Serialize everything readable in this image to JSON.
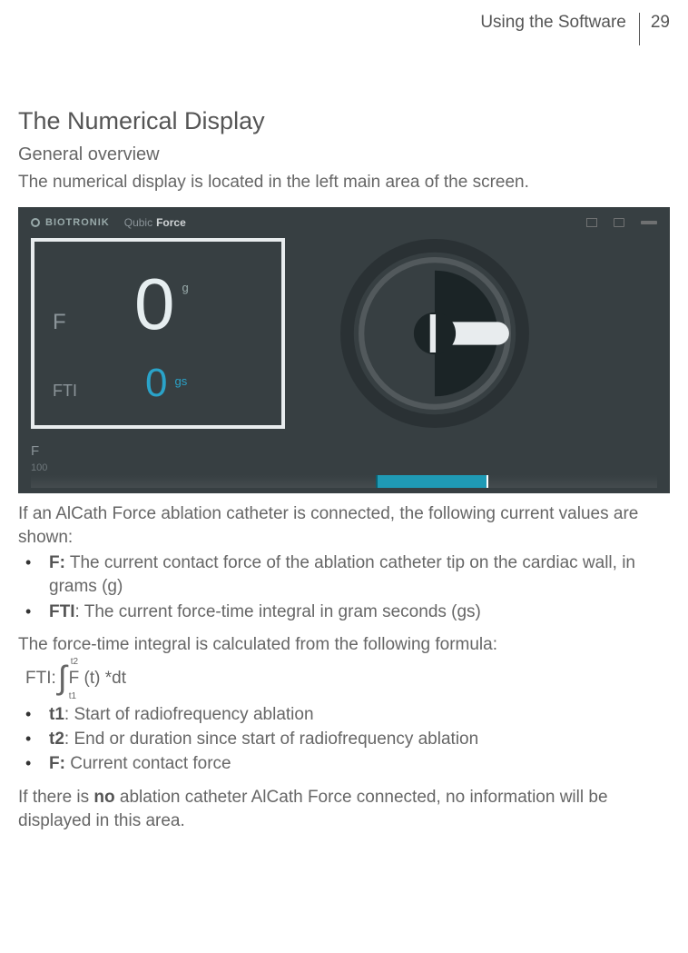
{
  "header": {
    "section": "Using the Software",
    "page": "29"
  },
  "h1": "The Numerical Display",
  "h2": "General overview",
  "intro": "The numerical display is located in the left main area of the screen.",
  "screenshot": {
    "brand": "BIOTRONIK",
    "product1": "Qubic",
    "product2": "Force",
    "f_label": "F",
    "f_value": "0",
    "f_unit": "g",
    "fti_label": "FTI",
    "fti_value": "0",
    "fti_unit": "gs",
    "bottom_label": "F",
    "bottom_num": "100"
  },
  "para1": "If an AlCath Force ablation catheter is connected, the following current values are shown:",
  "list1": [
    {
      "b": "F:",
      "t": " The current contact force of the ablation catheter tip on the cardiac wall, in grams (g)"
    },
    {
      "b": "FTI",
      "t": ": The current force-time integral in gram seconds (gs)"
    }
  ],
  "para2": "The force-time integral is calculated from the following formula:",
  "formula": {
    "lhs": "FTI:",
    "upper": "t2",
    "lower": "t1",
    "body": "F (t) *dt"
  },
  "list2": [
    {
      "b": "t1",
      "t": ": Start of radiofrequency ablation"
    },
    {
      "b": "t2",
      "t": ": End or duration since start of radiofrequency ablation"
    },
    {
      "b": "F:",
      "t": " Current contact force"
    }
  ],
  "para3a": "If there is ",
  "para3b": "no",
  "para3c": " ablation catheter AlCath Force connected, no information will be displayed in this area."
}
